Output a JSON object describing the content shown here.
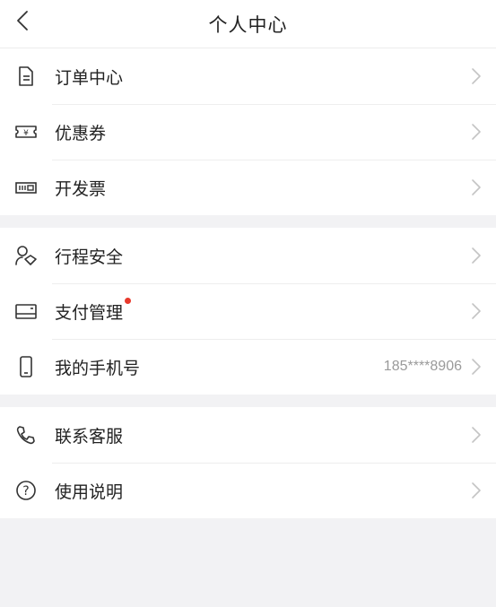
{
  "header": {
    "title": "个人中心"
  },
  "groups": [
    {
      "items": [
        {
          "label": "订单中心",
          "icon": "document-icon"
        },
        {
          "label": "优惠券",
          "icon": "coupon-icon"
        },
        {
          "label": "开发票",
          "icon": "invoice-icon"
        }
      ]
    },
    {
      "items": [
        {
          "label": "行程安全",
          "icon": "people-icon"
        },
        {
          "label": "支付管理",
          "icon": "wallet-icon",
          "badge": true
        },
        {
          "label": "我的手机号",
          "icon": "phone-icon",
          "value": "185****8906"
        }
      ]
    },
    {
      "items": [
        {
          "label": "联系客服",
          "icon": "telephone-icon"
        },
        {
          "label": "使用说明",
          "icon": "help-icon"
        }
      ]
    }
  ],
  "colors": {
    "badge": "#e8392c",
    "background": "#f2f2f4",
    "text": "#222222",
    "muted": "#9a9a9a"
  }
}
